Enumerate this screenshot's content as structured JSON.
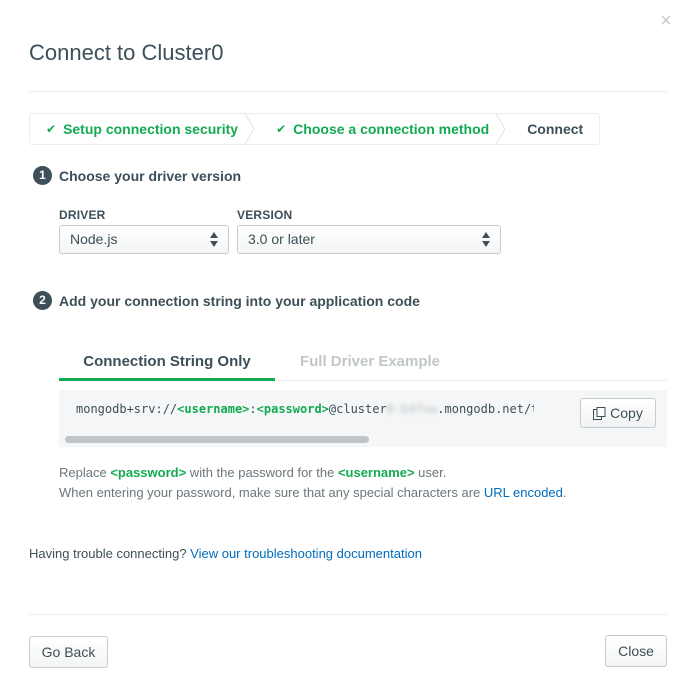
{
  "modal": {
    "title": "Connect to Cluster0",
    "close_icon": "×"
  },
  "breadcrumb": [
    {
      "label": "Setup connection security",
      "status": "done",
      "icon": "check-icon"
    },
    {
      "label": "Choose a connection method",
      "status": "done",
      "icon": "check-icon"
    },
    {
      "label": "Connect",
      "status": "active"
    }
  ],
  "step1": {
    "number": "1",
    "title": "Choose your driver version",
    "driver_label": "DRIVER",
    "driver_value": "Node.js",
    "version_label": "VERSION",
    "version_value": "3.0 or later"
  },
  "step2": {
    "number": "2",
    "title": "Add your connection string into your application code",
    "tabs": [
      {
        "label": "Connection String Only",
        "active": true
      },
      {
        "label": "Full Driver Example",
        "active": false
      }
    ],
    "connection_string": {
      "prefix": "mongodb+srv://",
      "username": "<username>",
      "colon": ":",
      "password": "<password>",
      "at_cluster": "@cluster",
      "blurred": "0-b4fvw",
      "suffix": ".mongodb.net/t"
    },
    "copy_label": "Copy",
    "note_line1": {
      "a": "Replace ",
      "password": "<password>",
      "b": " with the password for the ",
      "username": "<username>",
      "c": " user."
    },
    "note_line2": {
      "a": "When entering your password, make sure that any special characters are ",
      "link": "URL encoded",
      "b": "."
    }
  },
  "trouble": {
    "text": "Having trouble connecting? ",
    "link": "View our troubleshooting documentation"
  },
  "footer": {
    "back_label": "Go Back",
    "close_label": "Close"
  },
  "colors": {
    "accent": "#13aa52",
    "link": "#006cbc",
    "text": "#3d4f58"
  }
}
